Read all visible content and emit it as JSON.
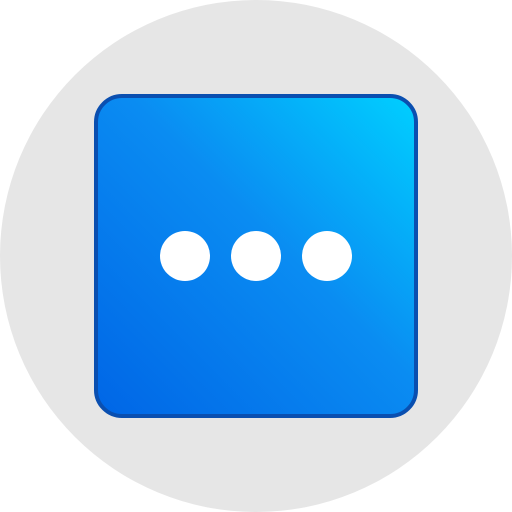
{
  "icon": {
    "name": "more-options-icon",
    "background_color": "#e6e6e6",
    "tile_gradient": [
      "#00cfff",
      "#0a8cf2",
      "#0066e6"
    ],
    "tile_border_color": "#0a4fb0",
    "dot_color": "#ffffff",
    "dot_count": 3
  }
}
